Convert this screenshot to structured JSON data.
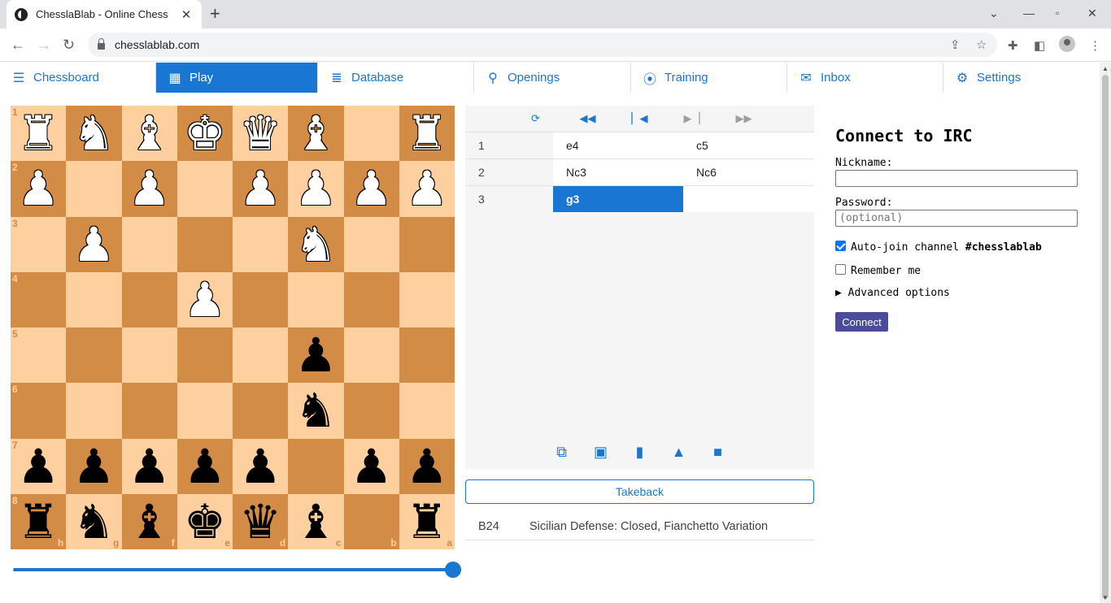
{
  "browser": {
    "tab_title": "ChesslaBlab - Online Chess",
    "url": "chesslablab.com"
  },
  "menu": [
    {
      "label": "Chessboard",
      "icon": "sliders-icon",
      "active": false
    },
    {
      "label": "Play",
      "icon": "keyboard-icon",
      "active": true
    },
    {
      "label": "Database",
      "icon": "database-icon",
      "active": false
    },
    {
      "label": "Openings",
      "icon": "search-icon",
      "active": false
    },
    {
      "label": "Training",
      "icon": "location-pin-icon",
      "active": false
    },
    {
      "label": "Inbox",
      "icon": "envelope-icon",
      "active": false
    },
    {
      "label": "Settings",
      "icon": "gear-icon",
      "active": false
    }
  ],
  "board": {
    "orientation": "black",
    "ranks": [
      "1",
      "2",
      "3",
      "4",
      "5",
      "6",
      "7",
      "8"
    ],
    "files": [
      "h",
      "g",
      "f",
      "e",
      "d",
      "c",
      "b",
      "a"
    ],
    "rows": [
      [
        "wR",
        "wN",
        "wB",
        "wK",
        "wQ",
        "wB",
        "",
        "wR"
      ],
      [
        "wP",
        "",
        "wP",
        "",
        "wP",
        "wP",
        "wP",
        "wP"
      ],
      [
        "",
        "wP",
        "",
        "",
        "",
        "wN",
        "",
        ""
      ],
      [
        "",
        "",
        "",
        "wP",
        "",
        "",
        "",
        ""
      ],
      [
        "",
        "",
        "",
        "",
        "",
        "bP",
        "",
        ""
      ],
      [
        "",
        "",
        "",
        "",
        "",
        "bN",
        "",
        ""
      ],
      [
        "bP",
        "bP",
        "bP",
        "bP",
        "bP",
        "",
        "bP",
        "bP"
      ],
      [
        "bR",
        "bN",
        "bB",
        "bK",
        "bQ",
        "bB",
        "",
        "bR"
      ]
    ],
    "slider_position": 1.0
  },
  "moves": [
    {
      "num": "1",
      "white": "e4",
      "black": "c5"
    },
    {
      "num": "2",
      "white": "Nc3",
      "black": "Nc6"
    },
    {
      "num": "3",
      "white": "g3",
      "black": ""
    }
  ],
  "current_move": "g3",
  "takeback_label": "Takeback",
  "opening": {
    "eco": "B24",
    "name": "Sicilian Defense: Closed, Fianchetto Variation"
  },
  "irc": {
    "title": "Connect to IRC",
    "nickname_label": "Nickname:",
    "nickname_value": "",
    "password_label": "Password:",
    "password_placeholder": "(optional)",
    "autojoin_label": "Auto-join channel",
    "autojoin_channel": "#chesslablab",
    "autojoin_checked": true,
    "remember_label": "Remember me",
    "remember_checked": false,
    "advanced_label": "Advanced options",
    "connect_label": "Connect"
  }
}
